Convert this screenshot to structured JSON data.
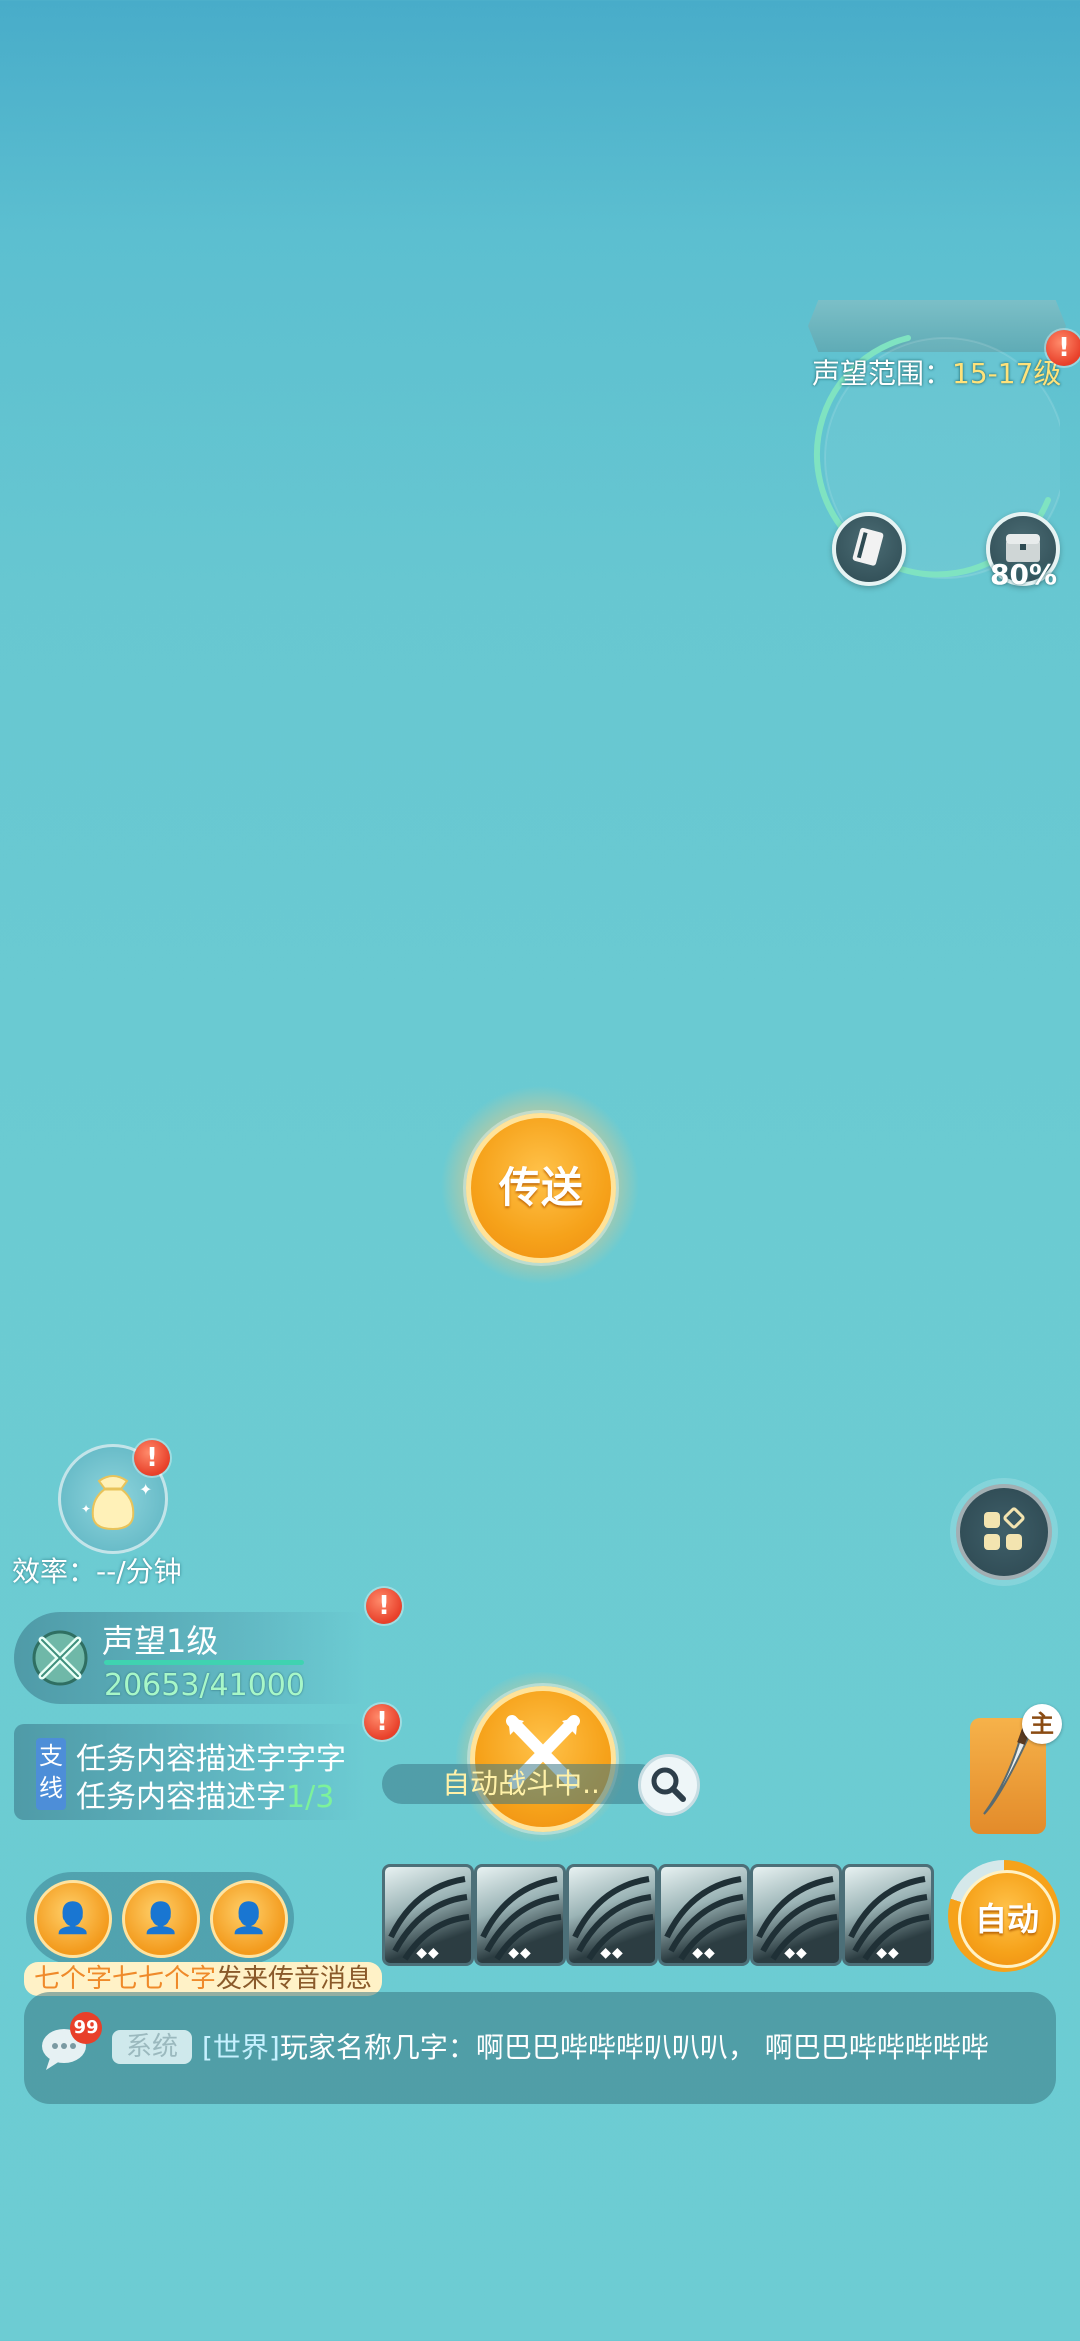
{
  "minimap": {
    "range_label": "声望范围：",
    "range_value": "15-17级",
    "progress_text": "80%",
    "progress": 0.8
  },
  "teleport": {
    "label": "传送"
  },
  "efficiency": {
    "text": "效率：--/分钟"
  },
  "fame": {
    "title": "声望1级",
    "value": "20653/41000"
  },
  "task": {
    "tag": "支线",
    "line1": "任务内容描述字字字",
    "line2_prefix": "任务内容描述字",
    "line2_progress": "1/3"
  },
  "fight": {
    "status": "自动战斗中.."
  },
  "weapon": {
    "tag": "主"
  },
  "auto": {
    "label": "自动",
    "progress": 0.8
  },
  "skills": {
    "count": 6
  },
  "voice": {
    "sender": "七个字七七个字",
    "suffix": "发来传音消息"
  },
  "chat": {
    "unread": "99",
    "tag": "系统",
    "channel": "[世界]",
    "message": "玩家名称几字：啊巴巴哔哔哔叭叭叭， 啊巴巴哔哔哔哔哔"
  },
  "colors": {
    "accent": "#f6a21a",
    "alert": "#e8402a",
    "progress_green": "#7df29a"
  }
}
